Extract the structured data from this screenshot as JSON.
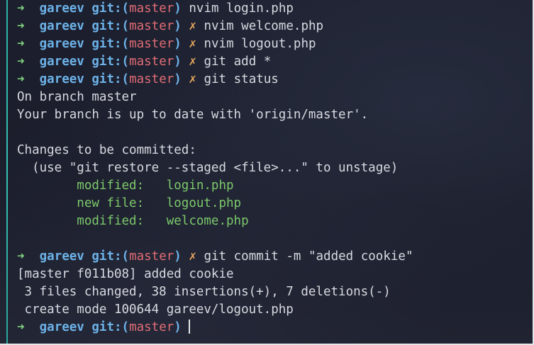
{
  "terminal": {
    "prompt": {
      "arrow": "➜",
      "user": "gareev",
      "git_open": "git:(",
      "branch": "master",
      "git_close": ")",
      "dirty_mark": "✗"
    },
    "lines": [
      {
        "type": "prompt",
        "dirty": false,
        "command": "nvim login.php"
      },
      {
        "type": "prompt",
        "dirty": true,
        "command": "nvim welcome.php"
      },
      {
        "type": "prompt",
        "dirty": true,
        "command": "nvim logout.php"
      },
      {
        "type": "prompt",
        "dirty": true,
        "command": "git add *"
      },
      {
        "type": "prompt",
        "dirty": true,
        "command": "git status"
      },
      {
        "type": "output",
        "text": "On branch master"
      },
      {
        "type": "output",
        "text": "Your branch is up to date with 'origin/master'."
      },
      {
        "type": "output",
        "text": ""
      },
      {
        "type": "output",
        "text": "Changes to be committed:"
      },
      {
        "type": "output",
        "text": "  (use \"git restore --staged <file>...\" to unstage)"
      },
      {
        "type": "staged",
        "label": "        modified:   ",
        "file": "login.php"
      },
      {
        "type": "staged",
        "label": "        new file:   ",
        "file": "logout.php"
      },
      {
        "type": "staged",
        "label": "        modified:   ",
        "file": "welcome.php"
      },
      {
        "type": "output",
        "text": ""
      },
      {
        "type": "prompt",
        "dirty": true,
        "command": "git commit -m \"added cookie\""
      },
      {
        "type": "output",
        "text": "[master f011b08] added cookie"
      },
      {
        "type": "output",
        "text": " 3 files changed, 38 insertions(+), 7 deletions(-)"
      },
      {
        "type": "output",
        "text": " create mode 100644 gareev/logout.php"
      },
      {
        "type": "prompt",
        "dirty": false,
        "command": "",
        "cursor": true
      }
    ]
  },
  "colors": {
    "background": "#1a1d2b",
    "accent_bar": "#2bb3a6",
    "arrow": "#7ed27e",
    "user": "#6cb2e8",
    "branch": "#e06c75",
    "dirty": "#e5a65c",
    "staged_file": "#7cc96b",
    "text": "#d7dae0"
  }
}
